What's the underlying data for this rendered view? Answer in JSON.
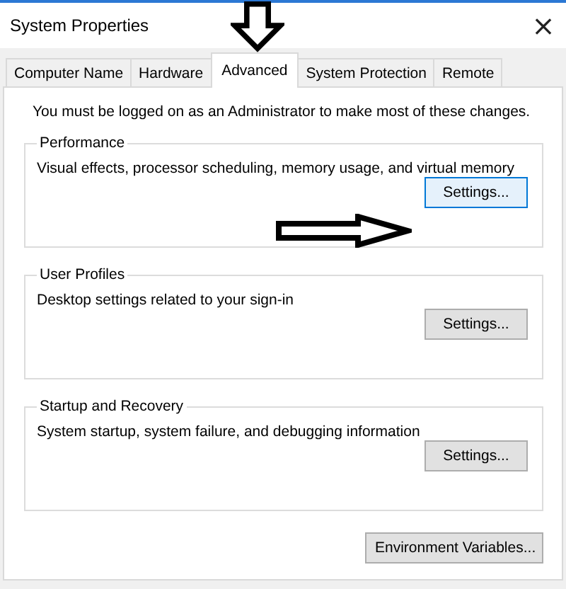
{
  "window": {
    "title": "System Properties",
    "close": "×"
  },
  "tabs": [
    {
      "label": "Computer Name",
      "selected": false
    },
    {
      "label": "Hardware",
      "selected": false
    },
    {
      "label": "Advanced",
      "selected": true
    },
    {
      "label": "System Protection",
      "selected": false
    },
    {
      "label": "Remote",
      "selected": false
    }
  ],
  "notice": "You must be logged on as an Administrator to make most of these changes.",
  "groups": [
    {
      "title": "Performance",
      "description": "Visual effects, processor scheduling, memory usage, and virtual memory",
      "button": {
        "label": "Settings...",
        "focused": true
      }
    },
    {
      "title": "User Profiles",
      "description": "Desktop settings related to your sign-in",
      "button": {
        "label": "Settings...",
        "focused": false
      }
    },
    {
      "title": "Startup and Recovery",
      "description": "System startup, system failure, and debugging information",
      "button": {
        "label": "Settings...",
        "focused": false
      }
    }
  ],
  "footer_button": {
    "label": "Environment Variables...",
    "focused": false
  }
}
